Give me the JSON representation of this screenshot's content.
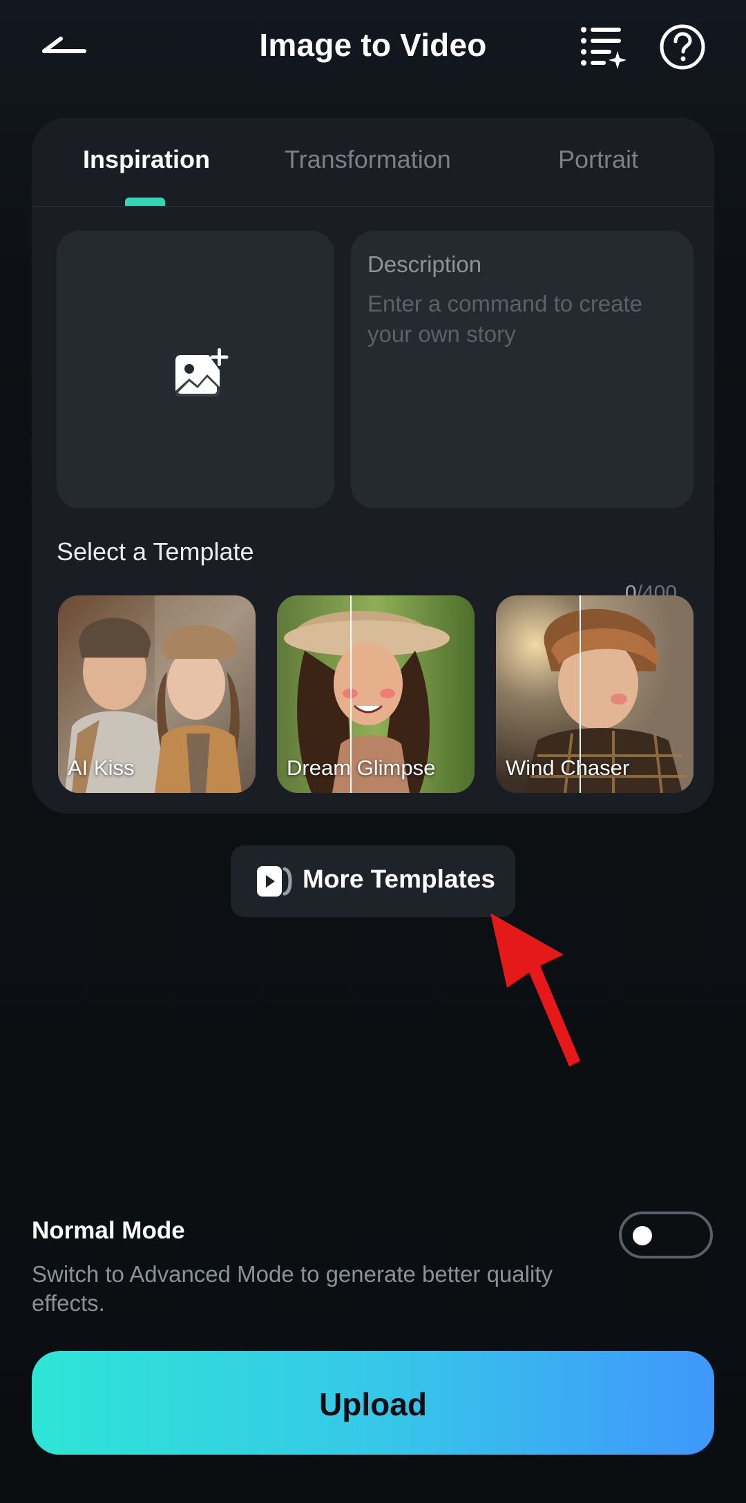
{
  "header": {
    "title": "Image to Video",
    "back_icon": "back-arrow-icon",
    "list_icon": "task-list-sparkle-icon",
    "help_icon": "help-circle-icon"
  },
  "tabs": [
    {
      "label": "Inspiration",
      "active": true
    },
    {
      "label": "Transformation",
      "active": false
    },
    {
      "label": "Portrait",
      "active": false
    }
  ],
  "upload_slot": {
    "icon": "add-image-icon"
  },
  "description": {
    "label": "Description",
    "value": "",
    "placeholder": "Enter a command to create your own story",
    "count": "0",
    "max": "/400"
  },
  "templates_section": {
    "title": "Select a Template",
    "items": [
      {
        "label": "AI Kiss"
      },
      {
        "label": "Dream Glimpse"
      },
      {
        "label": "Wind Chaser"
      }
    ]
  },
  "more_templates": {
    "label": "More Templates",
    "icon": "template-play-icon"
  },
  "annotation": {
    "color": "#e5191a",
    "icon": "red-pointer-arrow"
  },
  "mode": {
    "title": "Normal Mode",
    "description": "Switch to Advanced Mode to generate better quality effects.",
    "advanced_enabled": false
  },
  "upload_button": {
    "label": "Upload"
  },
  "colors": {
    "accent": "#36d6b4",
    "upload_gradient_start": "#2ee5d5",
    "upload_gradient_end": "#3f97fb",
    "card_bg": "#1a1e24"
  }
}
